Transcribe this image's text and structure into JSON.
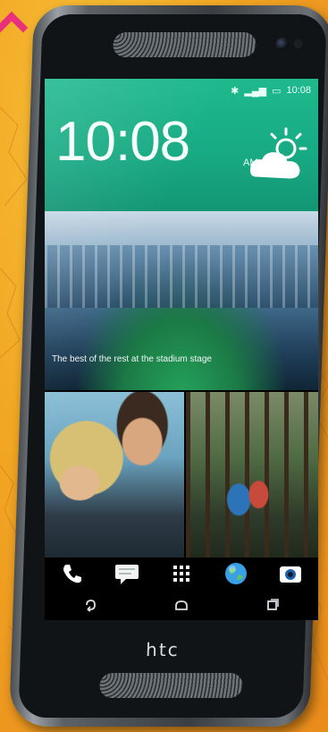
{
  "status_bar": {
    "time": "10:08"
  },
  "clock_widget": {
    "time": "10:08",
    "ampm": "AM",
    "date": "",
    "weather_icon": "partly-cloudy-icon"
  },
  "feed": {
    "caption": "The best of the rest at the stadium stage",
    "source": ""
  },
  "dock": {
    "items": [
      {
        "name": "phone",
        "icon": "phone-icon",
        "color": "#ffffff"
      },
      {
        "name": "messages",
        "icon": "message-icon",
        "color": "#f2f2f2"
      },
      {
        "name": "apps",
        "icon": "app-grid-icon",
        "color": "#ffffff"
      },
      {
        "name": "browser",
        "icon": "globe-icon",
        "color": "#3aa0e6"
      },
      {
        "name": "camera",
        "icon": "camera-icon",
        "color": "#ffffff"
      }
    ]
  },
  "nav": {
    "items": [
      {
        "name": "back",
        "icon": "back-icon"
      },
      {
        "name": "home",
        "icon": "home-icon"
      },
      {
        "name": "recent",
        "icon": "recent-apps-icon"
      }
    ]
  },
  "device": {
    "brand": "htc"
  },
  "colors": {
    "background": "#f2a623",
    "clock_panel": "#1fb98e",
    "phone_body": "#5c6166",
    "accent_pink": "#e8317a"
  }
}
